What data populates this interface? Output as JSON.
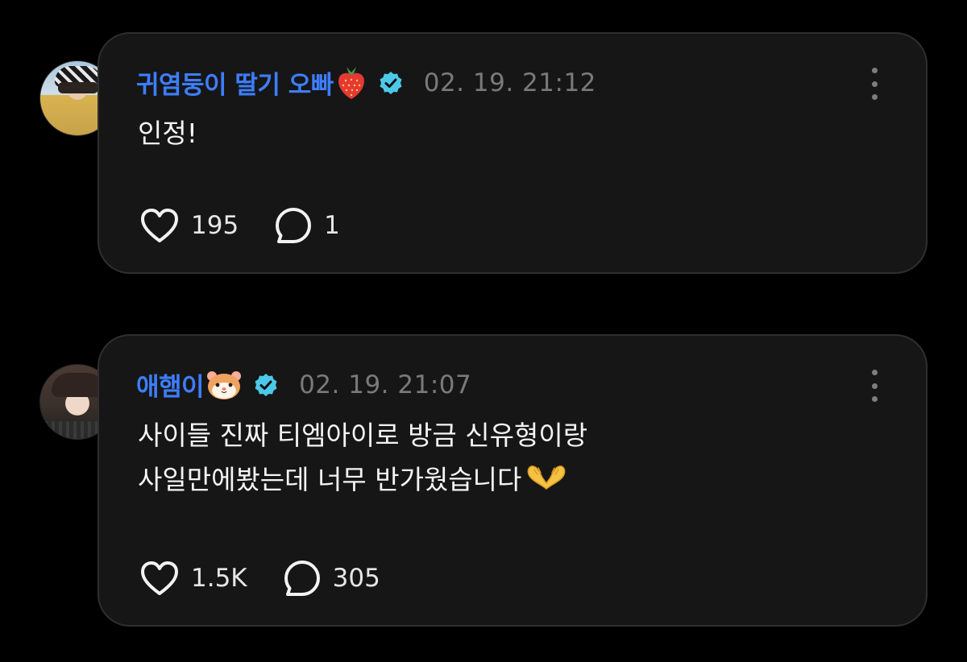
{
  "comments": [
    {
      "username": "귀염둥이 딸기 오빠",
      "username_emoji": "strawberry",
      "verified": true,
      "timestamp": "02. 19. 21:12",
      "text_lines": [
        "인정!"
      ],
      "likes": "195",
      "replies": "1"
    },
    {
      "username": "애햄이",
      "username_emoji": "hamster-face",
      "verified": true,
      "timestamp": "02. 19. 21:07",
      "text_lines": [
        "사이들 진짜 티엠아이로 방금 신유형이랑",
        "사일만에봤는데 너무 반가웠습니다"
      ],
      "text_emoji": "heart-hands",
      "likes": "1.5K",
      "replies": "305"
    }
  ],
  "colors": {
    "background": "#000000",
    "card": "#161616",
    "card_border": "#2f2f2f",
    "username": "#3d7eff",
    "verified_badge": "#4cc9e8",
    "timestamp": "#7a7a7a",
    "text": "#f4f4f4"
  },
  "icons": [
    "heart-icon",
    "comment-bubble-icon",
    "more-options-icon",
    "verified-badge-icon"
  ]
}
